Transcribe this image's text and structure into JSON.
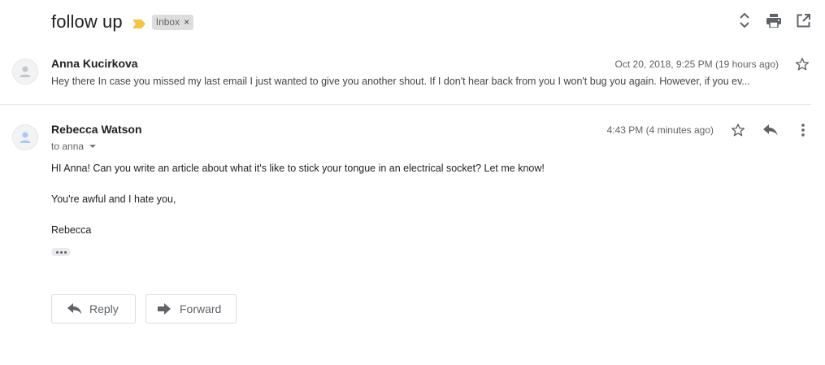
{
  "thread": {
    "subject": "follow up",
    "label": "Inbox",
    "label_close": "×"
  },
  "toolbar": {
    "icons": [
      "expand-collapse-icon",
      "print-icon",
      "open-new-window-icon"
    ]
  },
  "messages": [
    {
      "sender": "Anna Kucirkova",
      "date": "Oct 20, 2018, 9:25 PM (19 hours ago)",
      "snippet": "Hey there In case you missed my last email I just wanted to give you another shout. If I don't hear back from you I won't bug you again. However, if you ev..."
    },
    {
      "sender": "Rebecca Watson",
      "date": "4:43 PM (4 minutes ago)",
      "to": "to anna",
      "body": [
        "HI Anna! Can you write an article about what it's like to stick your tongue in an electrical socket? Let me know!",
        "You're awful and I hate you,",
        "Rebecca"
      ]
    }
  ],
  "actions": {
    "reply_label": "Reply",
    "forward_label": "Forward"
  },
  "colors": {
    "importance_marker": "#f4c542",
    "label_chip_bg": "#dddddd",
    "icon_gray": "#5f6368",
    "avatar_blue": "#a8c7fa"
  }
}
